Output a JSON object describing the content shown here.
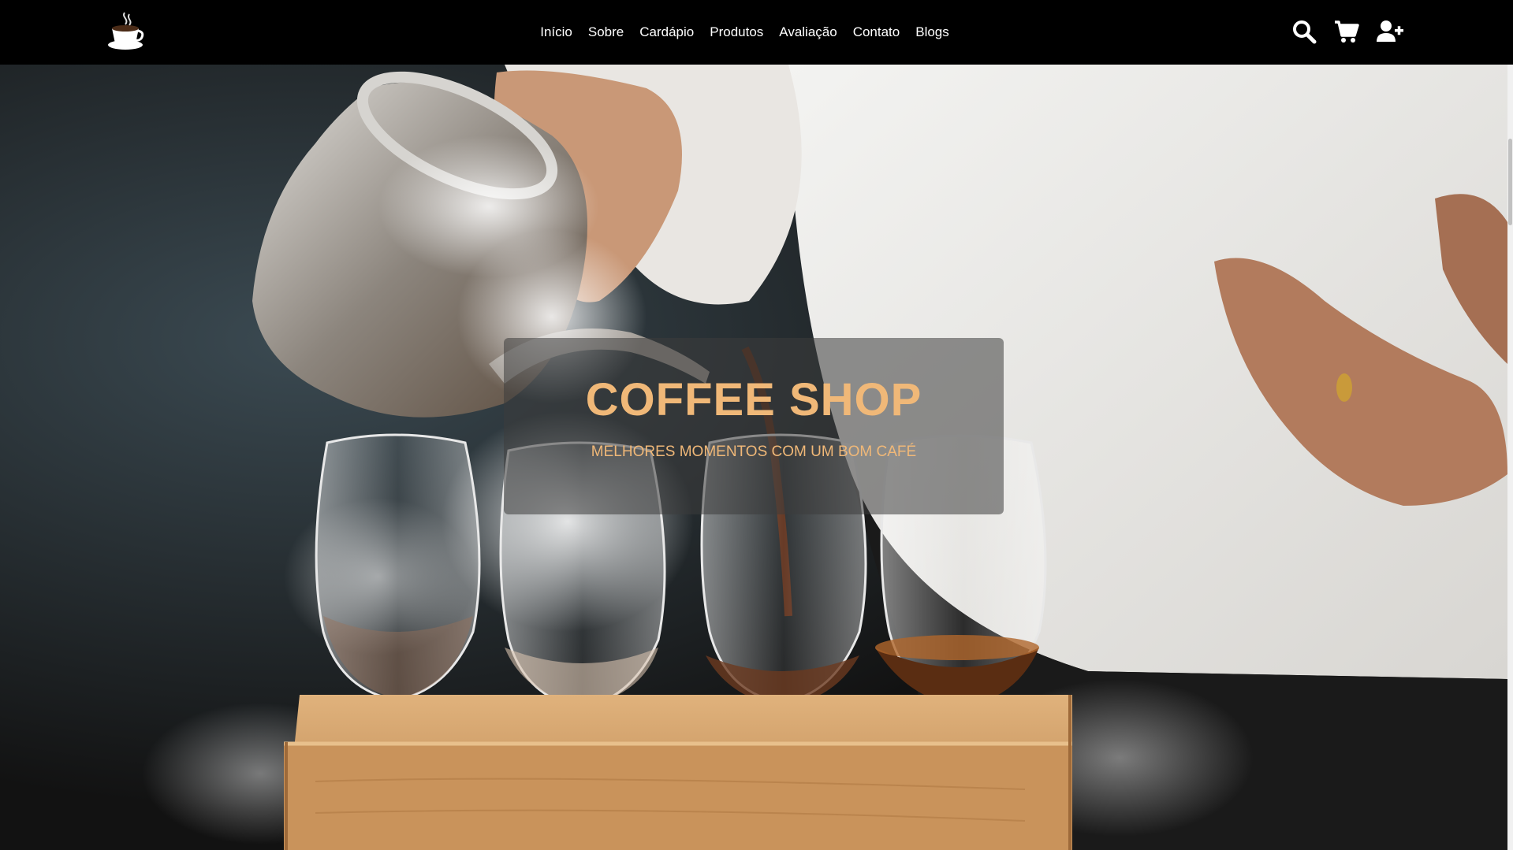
{
  "nav": {
    "logo_icon": "coffee-cup-icon",
    "links": [
      {
        "label": "Início"
      },
      {
        "label": "Sobre"
      },
      {
        "label": "Cardápio"
      },
      {
        "label": "Produtos"
      },
      {
        "label": "Avaliação"
      },
      {
        "label": "Contato"
      },
      {
        "label": "Blogs"
      }
    ],
    "icons": [
      "search-icon",
      "cart-icon",
      "user-plus-icon"
    ]
  },
  "hero": {
    "title": "COFFEE SHOP",
    "subtitle": "MELHORES MOMENTOS COM UM BOM CAFÉ"
  },
  "colors": {
    "header_bg": "#000000",
    "accent": "#f0b878",
    "overlay": "rgba(60,60,60,0.55)"
  }
}
